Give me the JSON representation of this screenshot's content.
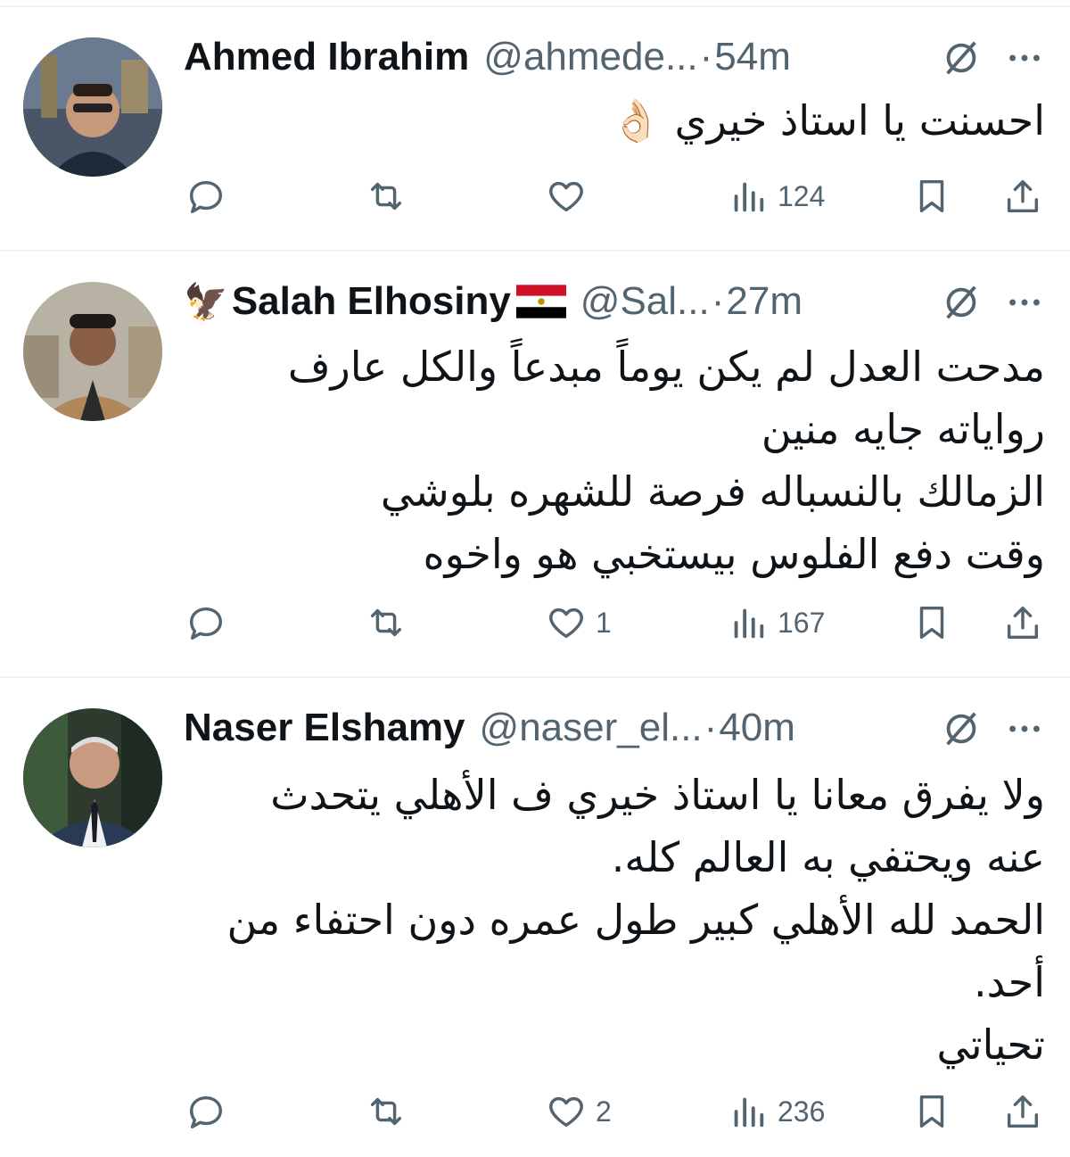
{
  "tweets": [
    {
      "name": "Ahmed Ibrahim",
      "handle": "@ahmede...",
      "separator": "·",
      "time": "54m",
      "lines": [
        "احسنت يا استاذ خيري 👌🏻"
      ],
      "actions": {
        "replies": "",
        "retweets": "",
        "likes": "",
        "views": "124"
      }
    },
    {
      "name": "Salah Elhosiny",
      "name_prefix_emoji": "🦅",
      "name_suffix_flag": "egypt-flag",
      "handle": "@Sal...",
      "separator": "·",
      "time": "27m",
      "lines": [
        "مدحت العدل لم يكن يوماً مبدعاً والكل عارف",
        "رواياته جايه منين",
        "الزمالك بالنسباله فرصة للشهره بلوشي",
        "وقت دفع الفلوس بيستخبي هو واخوه"
      ],
      "actions": {
        "replies": "",
        "retweets": "",
        "likes": "1",
        "views": "167"
      }
    },
    {
      "name": "Naser Elshamy",
      "handle": "@naser_el...",
      "separator": "·",
      "time": "40m",
      "lines": [
        "ولا يفرق معانا يا استاذ خيري ف الأهلي يتحدث",
        "عنه ويحتفي به العالم كله.",
        "الحمد لله الأهلي كبير طول عمره دون احتفاء من",
        "أحد.",
        "تحياتي"
      ],
      "actions": {
        "replies": "",
        "retweets": "",
        "likes": "2",
        "views": "236"
      }
    }
  ],
  "icons": {
    "reply": "reply-icon",
    "retweet": "retweet-icon",
    "like": "heart-icon",
    "views": "views-icon",
    "bookmark": "bookmark-icon",
    "share": "share-icon",
    "grok": "grok-icon",
    "more": "more-icon"
  },
  "colors": {
    "text": "#0f1419",
    "secondary": "#536471",
    "divider": "#eff3f4"
  }
}
